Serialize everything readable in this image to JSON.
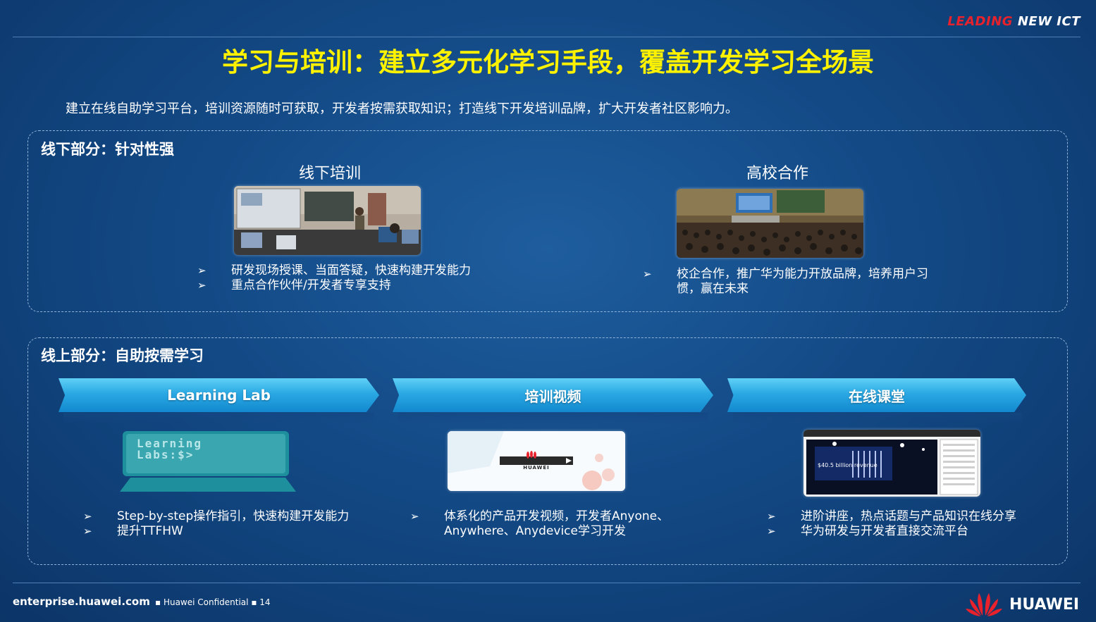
{
  "brand": {
    "part1": "LEADING",
    "part2": "NEW ICT"
  },
  "title": "学习与培训：建立多元化学习手段，覆盖开发学习全场景",
  "intro": "建立在线自助学习平台，培训资源随时可获取，开发者按需获取知识；打造线下开发培训品牌，扩大开发者社区影响力。",
  "offline": {
    "label": "线下部分：针对性强",
    "training": {
      "title": "线下培训",
      "bullets": [
        "研发现场授课、当面答疑，快速构建开发能力",
        "重点合作伙伴/开发者专享支持"
      ]
    },
    "university": {
      "title": "高校合作",
      "bullets": [
        "校企合作，推广华为能力开放品牌，培养用户习惯，赢在未来"
      ]
    }
  },
  "online": {
    "label": "线上部分：自助按需学习",
    "columns": [
      {
        "banner": "Learning Lab",
        "screen_text_1": "Learning",
        "screen_text_2": "Labs:$>",
        "bullets": [
          "Step-by-step操作指引，快速构建开发能力",
          "提升TTFHW"
        ]
      },
      {
        "banner": "培训视频",
        "video_logo": "HUAWEI",
        "bullets": [
          "体系化的产品开发视频，开发者Anyone、Anywhere、Anydevice学习开发"
        ]
      },
      {
        "banner": "在线课堂",
        "screen_text": "$40.5 billion revenue",
        "bullets": [
          "进阶讲座，热点话题与产品知识在线分享",
          "华为研发与开发者直接交流平台"
        ]
      }
    ]
  },
  "footer": {
    "url": "enterprise.huawei.com",
    "confidential": "Huawei Confidential",
    "page": "14",
    "logo_text": "HUAWEI"
  },
  "colors": {
    "title": "#fff200",
    "brand_red": "#e8222c",
    "banner": "#2aa8e3",
    "background": "#134a86"
  },
  "icons": [
    "arrow-bullet-icon",
    "huawei-logo-icon"
  ]
}
